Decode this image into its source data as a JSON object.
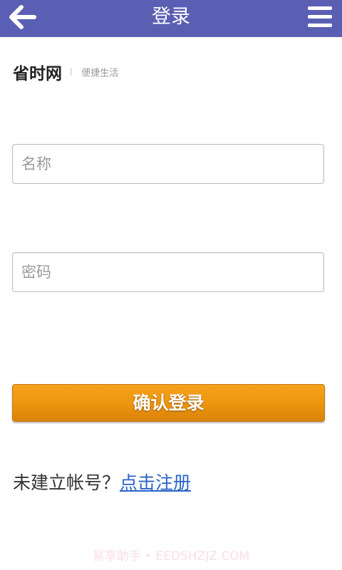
{
  "header": {
    "title": "登录",
    "back_icon": "arrow-left-icon",
    "menu_icon": "hamburger-menu-icon",
    "background_color": "#5a5fb3"
  },
  "brand": {
    "name": "省时网",
    "slogan": "便捷生活"
  },
  "form": {
    "name_placeholder": "名称",
    "name_value": "",
    "password_placeholder": "密码",
    "password_value": "",
    "submit_label": "确认登录",
    "submit_color": "#ef970f"
  },
  "register": {
    "prompt": "未建立帐号？",
    "link_label": "点击注册",
    "link_color": "#2a63c9"
  },
  "watermark": {
    "text": "易享助手 • EEDSHZJZ.COM"
  }
}
